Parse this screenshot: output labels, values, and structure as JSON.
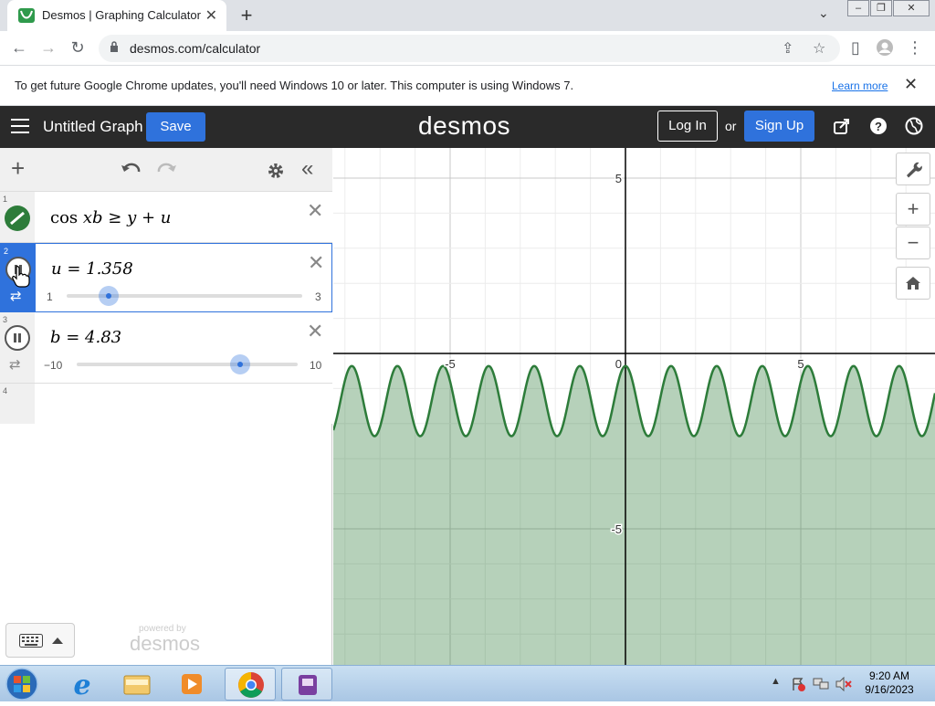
{
  "browser": {
    "tab_title": "Desmos | Graphing Calculator",
    "tab_close": "✕",
    "new_tab": "+",
    "url": "desmos.com/calculator",
    "infobar_message": "To get future Google Chrome updates, you'll need Windows 10 or later. This computer is using Windows 7.",
    "infobar_link": "Learn more",
    "infobar_close": "✕"
  },
  "header": {
    "graph_title": "Untitled Graph",
    "save_label": "Save",
    "logo": "desmos",
    "login_label": "Log In",
    "or_label": "or",
    "signup_label": "Sign Up"
  },
  "expressions": [
    {
      "num": "1",
      "latex_parts": [
        "cos",
        "xb ≥ y + u"
      ],
      "color": "#2d7c3a"
    },
    {
      "num": "2",
      "text": "u = 1.358",
      "slider": {
        "min": "1",
        "max": "3",
        "value": 1.358,
        "min_num": 1,
        "max_num": 3
      }
    },
    {
      "num": "3",
      "text": "b = 4.83",
      "slider": {
        "min": "−10",
        "max": "10",
        "value": 4.83,
        "min_num": -10,
        "max_num": 10
      }
    },
    {
      "num": "4"
    }
  ],
  "panel": {
    "powered_by": "powered by",
    "powered_logo": "desmos"
  },
  "graph": {
    "x_ticks": [
      {
        "value": -5,
        "label": "-5"
      },
      {
        "value": 0,
        "label": "0"
      },
      {
        "value": 5,
        "label": "5"
      }
    ],
    "y_ticks": [
      {
        "value": 5,
        "label": "5"
      },
      {
        "value": -5,
        "label": "-5"
      }
    ],
    "fill_color": "#2d7c3a",
    "curve_color": "#2d7c3a",
    "b": 4.83,
    "u": 1.358
  },
  "taskbar": {
    "time": "9:20 AM",
    "date": "9/16/2023"
  }
}
